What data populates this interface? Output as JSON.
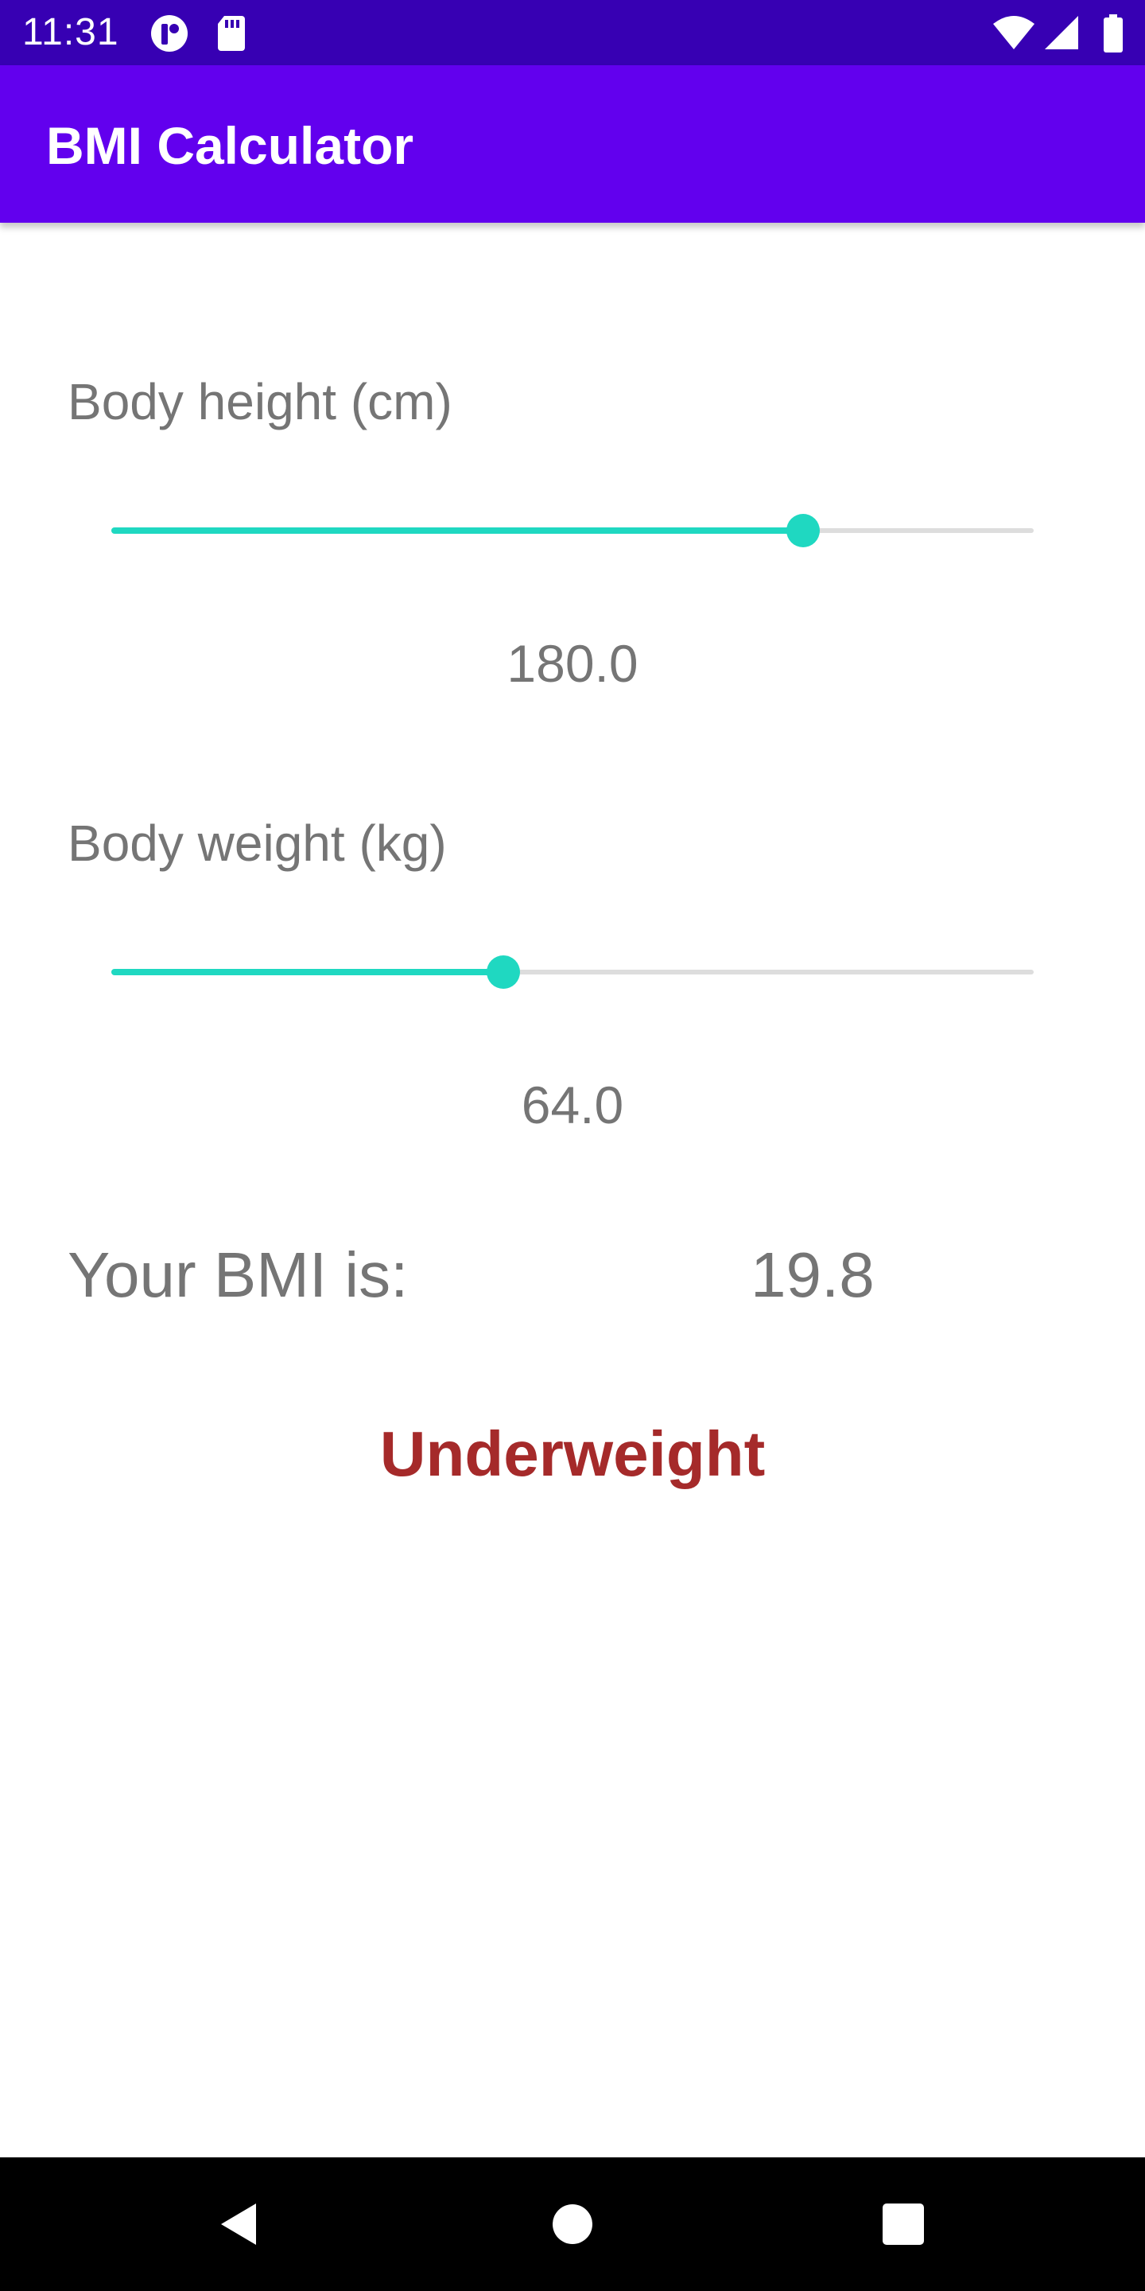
{
  "status_bar": {
    "time": "11:31",
    "background": "#3700b3",
    "left_icons": [
      "app-notification-icon",
      "sd-card-icon"
    ],
    "right_icons": [
      "wifi-icon",
      "cell-signal-icon",
      "battery-icon"
    ]
  },
  "app_bar": {
    "title": "BMI Calculator",
    "background": "#6200ee"
  },
  "height": {
    "label": "Body height (cm)",
    "value": "180.0",
    "slider_fraction": 0.75
  },
  "weight": {
    "label": "Body weight (kg)",
    "value": "64.0",
    "slider_fraction": 0.425
  },
  "result": {
    "label": "Your BMI is:",
    "value": "19.8",
    "category": "Underweight",
    "category_color": "#a52a2a"
  },
  "colors": {
    "accent": "#1fd8c1",
    "text_secondary": "#757575"
  },
  "nav_bar": {
    "buttons": [
      "back-icon",
      "home-icon",
      "recents-icon"
    ]
  }
}
